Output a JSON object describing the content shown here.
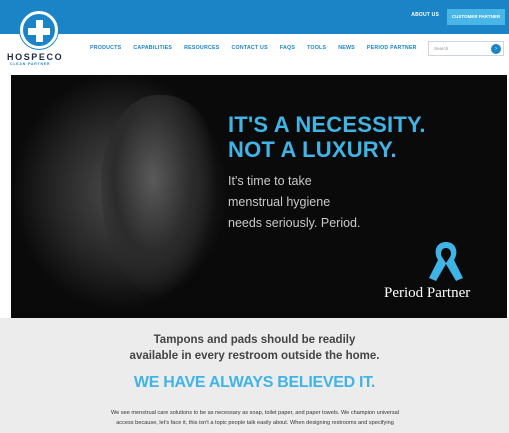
{
  "header": {
    "about_label": "ABOUT US",
    "portal_label": "CUSTOMER PARTNER",
    "brand_name": "HOSPECO",
    "brand_tagline": "CLEAN·PARTNER",
    "logo_icon": "plus-cross-icon"
  },
  "nav": {
    "items": [
      {
        "label": "PRODUCTS"
      },
      {
        "label": "CAPABILITIES"
      },
      {
        "label": "RESOURCES"
      },
      {
        "label": "CONTACT US"
      },
      {
        "label": "FAQS"
      },
      {
        "label": "TOOLS"
      },
      {
        "label": "NEWS"
      },
      {
        "label": "PERIOD PARTNER"
      }
    ],
    "search_placeholder": "Search",
    "search_icon": "search-icon"
  },
  "hero": {
    "headline_line1": "IT'S A NECESSITY.",
    "headline_line2": "NOT A LUXURY.",
    "sub_line1": "It's time to take",
    "sub_line2": "menstrual hygiene",
    "sub_line3": "needs seriously. Period.",
    "partner_logo_text": "Period Partner",
    "ribbon_icon": "awareness-ribbon-icon"
  },
  "band": {
    "question_line1": "Tampons and pads should be readily",
    "question_line2": "available in every restroom outside the home.",
    "believe": "WE HAVE ALWAYS BELIEVED IT.",
    "para_line1": "We see menstrual care solutions to be as necessary as soap, toilet paper, and paper towels. We champion universal",
    "para_line2": "access because, let's face it, this isn't a topic people talk easily about. When designing restrooms and specifying"
  },
  "colors": {
    "brand_blue": "#1a84c6",
    "accent_blue": "#3fb4e5",
    "band_gray": "#ececec"
  }
}
